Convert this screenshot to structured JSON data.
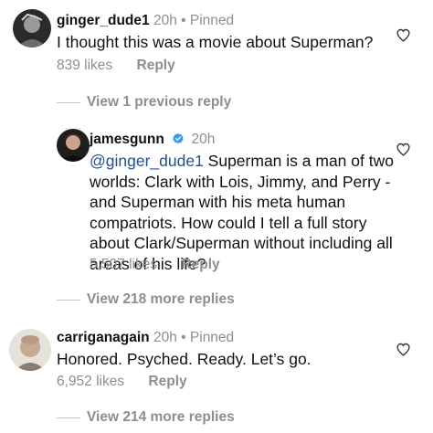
{
  "comments": [
    {
      "username": "ginger_dude1",
      "time": "20h",
      "separator": "•",
      "status": "Pinned",
      "text": "I thought this was a movie about Superman?",
      "likes": "839 likes",
      "reply_label": "Reply"
    },
    {
      "username": "jamesgunn",
      "time": "20h",
      "mention": "@ginger_dude1",
      "line1_rest": " Superman is a man of two",
      "line2": "worlds: Clark with Lois, Jimmy, and Perry -",
      "line3": "and Superman with his meta human",
      "line4": "compatriots. How could I tell a full story",
      "line5": "about Clark/Superman without including all",
      "line6": "areas of his life?",
      "likes": "5,507 likes",
      "reply_label": "Reply"
    },
    {
      "username": "carriganagain",
      "time": "20h",
      "separator": "•",
      "status": "Pinned",
      "text": "Honored. Psyched. Ready. Let’s go.",
      "likes": "6,952 likes",
      "reply_label": "Reply"
    }
  ],
  "threads": {
    "previous_replies": "View 1 previous reply",
    "more_replies_1": "View 218 more replies",
    "more_replies_2": "View 214 more replies"
  },
  "colors": {
    "verified": "#3897f0",
    "mention": "#1f4f94",
    "secondary_text": "#8e8e8e"
  },
  "icons": {
    "like": "heart-outline-icon",
    "verified": "verified-badge-icon"
  }
}
